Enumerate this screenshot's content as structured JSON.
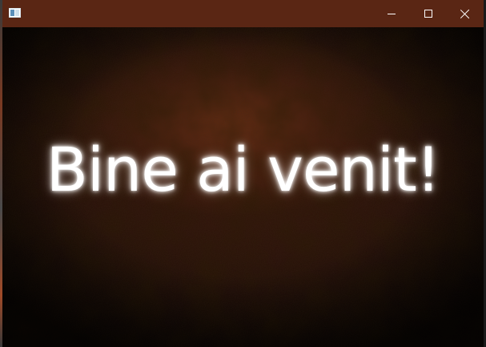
{
  "window": {
    "title": "",
    "titlebar_color": "#5a2614",
    "icons": {
      "app": "app-window-icon",
      "minimize": "minimize-icon",
      "maximize": "maximize-icon",
      "close": "close-icon"
    }
  },
  "main": {
    "welcome_text": "Bine ai venit!",
    "text_color": "#ffffff",
    "background_style": "dark grunge brown texture"
  }
}
